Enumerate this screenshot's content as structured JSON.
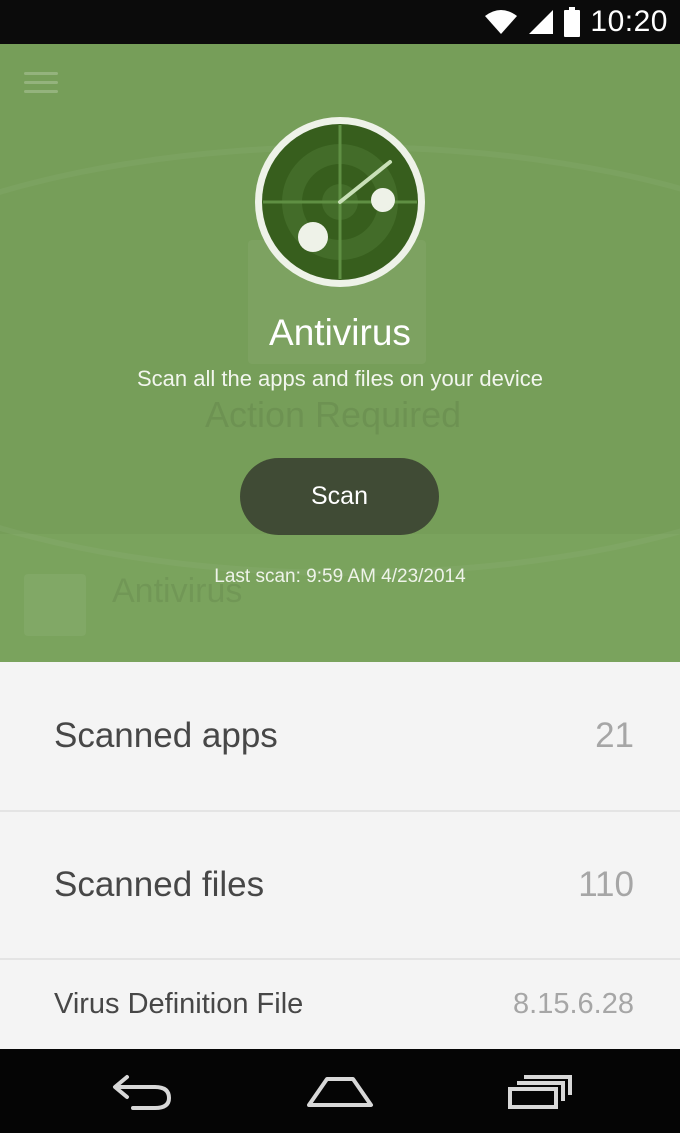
{
  "status_bar": {
    "time": "10:20",
    "icons": [
      "wifi-icon",
      "signal-icon",
      "battery-icon"
    ]
  },
  "header": {
    "menu_icon": "menu-icon",
    "logo_icon": "radar-icon",
    "title": "Antivirus",
    "subtitle": "Scan all the apps and files on your device",
    "scan_button_label": "Scan",
    "last_scan": "Last scan: 9:59 AM 4/23/2014"
  },
  "background_ghost": {
    "status": "Action Required",
    "card_title": "Antivirus"
  },
  "stats": [
    {
      "label": "Scanned apps",
      "value": "21"
    },
    {
      "label": "Scanned files",
      "value": "110"
    },
    {
      "label": "Virus Definition File",
      "value": "8.15.6.28"
    }
  ],
  "nav_bar": {
    "icons": [
      "back-icon",
      "home-icon",
      "recents-icon"
    ]
  },
  "colors": {
    "header_green": "#769e59",
    "scan_button": "#404b35",
    "radar_dark": "#375e1d",
    "radar_light": "#5f8f43",
    "list_background": "#f4f4f4"
  }
}
